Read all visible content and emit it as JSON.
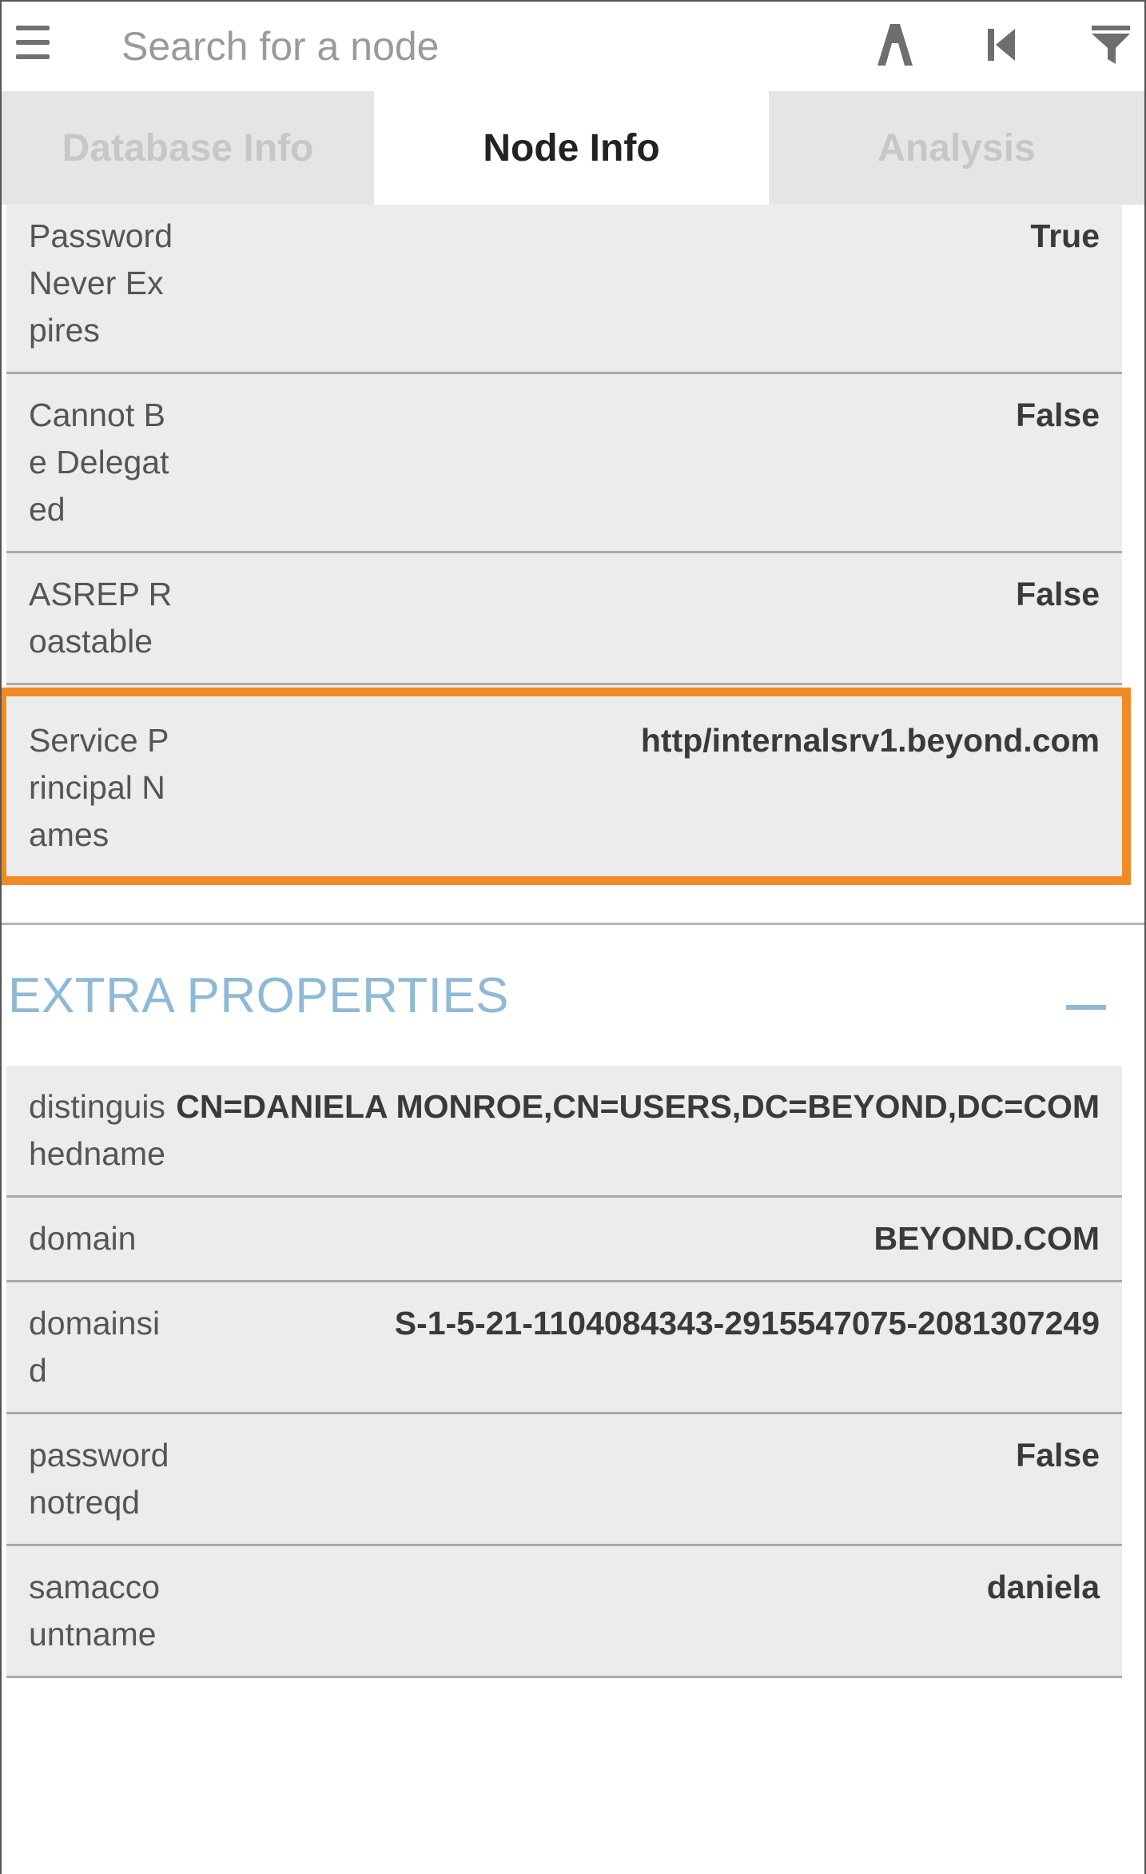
{
  "search": {
    "placeholder": "Search for a node"
  },
  "toolbar": {
    "icons": [
      "menu-icon",
      "pathfinding-icon",
      "back-icon",
      "filter-icon"
    ]
  },
  "tabs": [
    {
      "label": "Database Info",
      "active": false
    },
    {
      "label": "Node Info",
      "active": true
    },
    {
      "label": "Analysis",
      "active": false
    }
  ],
  "node_properties": [
    {
      "label": "Password Never Expires",
      "value": "True"
    },
    {
      "label": "Cannot Be Delegated",
      "value": "False"
    },
    {
      "label": "ASREP Roastable",
      "value": "False"
    },
    {
      "label": "Service Principal Names",
      "value": "http/internalsrv1.beyond.com"
    }
  ],
  "extra_properties": {
    "title": "EXTRA PROPERTIES",
    "collapse_symbol": "−",
    "rows": [
      {
        "label": "distinguishedname",
        "value": "CN=DANIELA MONROE,CN=USERS,DC=BEYOND,DC=COM"
      },
      {
        "label": "domain",
        "value": "BEYOND.COM"
      },
      {
        "label": "domainsid",
        "value": "S-1-5-21-1104084343-2915547075-2081307249"
      },
      {
        "label": "passwordnotreqd",
        "value": "False"
      },
      {
        "label": "samaccountname",
        "value": "daniela"
      }
    ]
  },
  "colors": {
    "highlight": "#f08a24",
    "section_title": "#8fb9d6",
    "row_background": "#ececec"
  }
}
